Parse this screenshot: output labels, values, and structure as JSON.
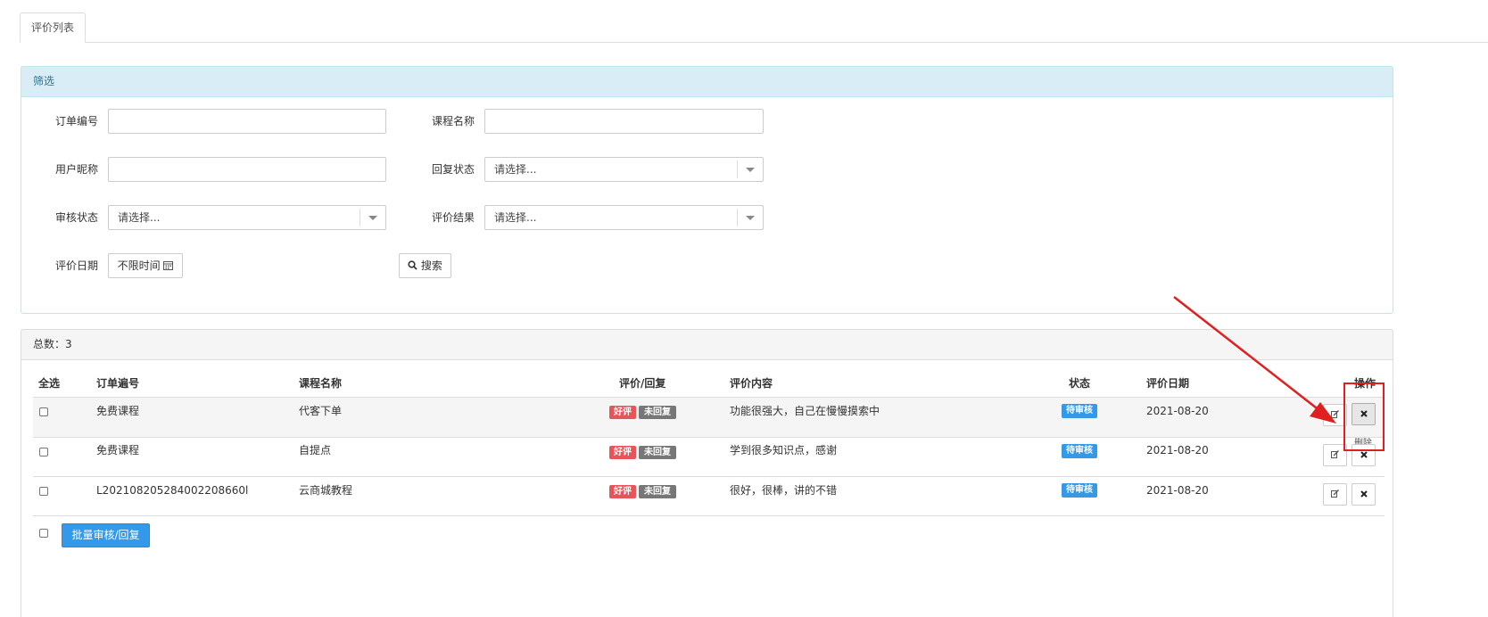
{
  "tabs": [
    {
      "label": "评价列表"
    }
  ],
  "filter": {
    "title": "筛选",
    "order_no_label": "订单编号",
    "course_name_label": "课程名称",
    "user_nick_label": "用户昵称",
    "reply_status_label": "回复状态",
    "reply_status_value": "请选择...",
    "review_status_label": "审核状态",
    "review_status_value": "请选择...",
    "rating_result_label": "评价结果",
    "rating_result_value": "请选择...",
    "date_label": "评价日期",
    "date_value": "不限时间",
    "search_label": "搜索"
  },
  "list": {
    "total_text": "总数：3",
    "columns": [
      "全选",
      "订单遍号",
      "课程名称",
      "评价/回复",
      "评价内容",
      "状态",
      "评价日期",
      "操作"
    ],
    "rows": [
      {
        "order_no": "免费课程",
        "course": "代客下单",
        "rating": "好评",
        "reply": "未回复",
        "content": "功能很强大，自己在慢慢摸索中",
        "status": "待审核",
        "date": "2021-08-20"
      },
      {
        "order_no": "免费课程",
        "course": "自提点",
        "rating": "好评",
        "reply": "未回复",
        "content": "学到很多知识点，感谢",
        "status": "待审核",
        "date": "2021-08-20"
      },
      {
        "order_no": "L202108205284002208660l",
        "course": "云商城教程",
        "rating": "好评",
        "reply": "未回复",
        "content": "很好，很棒，讲的不错",
        "status": "待审核",
        "date": "2021-08-20"
      }
    ],
    "delete_tooltip": "删除",
    "batch_label": "批量审核/回复"
  },
  "icons": {
    "edit": "edit-icon",
    "delete": "times-icon",
    "search": "search-icon",
    "calendar": "calendar-icon"
  },
  "colors": {
    "good": "#e9545a",
    "no_reply": "#777777",
    "pending": "#3499e8",
    "annotation": "#e02020"
  }
}
